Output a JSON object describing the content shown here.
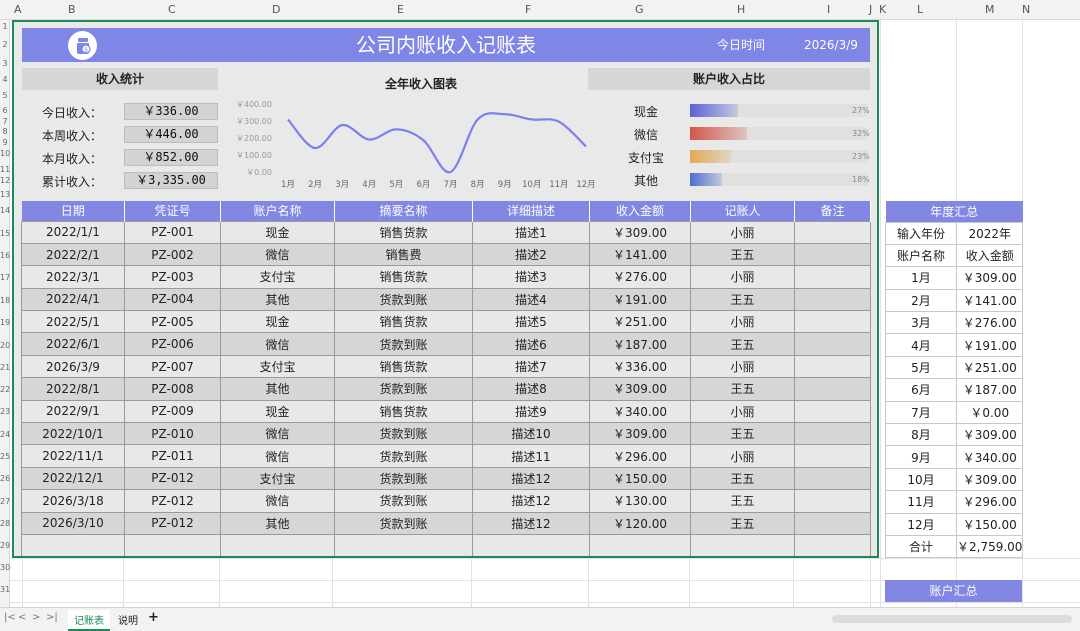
{
  "columns": [
    "A",
    "B",
    "C",
    "D",
    "E",
    "F",
    "G",
    "H",
    "I",
    "J",
    "K",
    "L",
    "M",
    "N"
  ],
  "rows": [
    "1",
    "2",
    "3",
    "4",
    "5",
    "6",
    "7",
    "8",
    "9",
    "10",
    "11",
    "12",
    "13",
    "14",
    "15",
    "16",
    "17",
    "18",
    "19",
    "20",
    "21",
    "22",
    "23",
    "24",
    "25",
    "26",
    "27",
    "28",
    "29",
    "30",
    "31"
  ],
  "banner": {
    "title": "公司内账收入记账表",
    "today_label": "今日时间",
    "today_date": "2026/3/9",
    "logo_icon": "money-bag-icon"
  },
  "stats": {
    "header": "收入统计",
    "items": [
      {
        "label": "今日收入：",
        "value": "￥336.00"
      },
      {
        "label": "本周收入：",
        "value": "￥446.00"
      },
      {
        "label": "本月收入：",
        "value": "￥852.00"
      },
      {
        "label": "累计收入：",
        "value": "￥3,335.00"
      }
    ]
  },
  "chart_data": {
    "type": "line",
    "title": "全年收入图表",
    "categories": [
      "1月",
      "2月",
      "3月",
      "4月",
      "5月",
      "6月",
      "7月",
      "8月",
      "9月",
      "10月",
      "11月",
      "12月"
    ],
    "values": [
      309,
      141,
      276,
      191,
      251,
      187,
      0,
      309,
      340,
      309,
      296,
      150
    ],
    "ylim": [
      0,
      400
    ],
    "yticks": [
      "￥0.00",
      "￥100.00",
      "￥200.00",
      "￥300.00",
      "￥400.00"
    ],
    "color": "#7b7ff0",
    "grid": false
  },
  "accounts": {
    "header": "账户收入占比",
    "items": [
      {
        "label": "现金",
        "pct": "27%",
        "fraction": 0.27,
        "color": "#5b63d6"
      },
      {
        "label": "微信",
        "pct": "32%",
        "fraction": 0.32,
        "color": "#d2574a"
      },
      {
        "label": "支付宝",
        "pct": "23%",
        "fraction": 0.23,
        "color": "#e2a955"
      },
      {
        "label": "其他",
        "pct": "18%",
        "fraction": 0.18,
        "color": "#4d6fcf"
      }
    ]
  },
  "table": {
    "headers": [
      "日期",
      "凭证号",
      "账户名称",
      "摘要名称",
      "详细描述",
      "收入金额",
      "记账人",
      "备注"
    ],
    "rows": [
      [
        "2022/1/1",
        "PZ-001",
        "现金",
        "销售货款",
        "描述1",
        "￥309.00",
        "小丽",
        ""
      ],
      [
        "2022/2/1",
        "PZ-002",
        "微信",
        "销售费",
        "描述2",
        "￥141.00",
        "王五",
        ""
      ],
      [
        "2022/3/1",
        "PZ-003",
        "支付宝",
        "销售货款",
        "描述3",
        "￥276.00",
        "小丽",
        ""
      ],
      [
        "2022/4/1",
        "PZ-004",
        "其他",
        "货款到账",
        "描述4",
        "￥191.00",
        "王五",
        ""
      ],
      [
        "2022/5/1",
        "PZ-005",
        "现金",
        "销售货款",
        "描述5",
        "￥251.00",
        "小丽",
        ""
      ],
      [
        "2022/6/1",
        "PZ-006",
        "微信",
        "货款到账",
        "描述6",
        "￥187.00",
        "王五",
        ""
      ],
      [
        "2026/3/9",
        "PZ-007",
        "支付宝",
        "销售货款",
        "描述7",
        "￥336.00",
        "小丽",
        ""
      ],
      [
        "2022/8/1",
        "PZ-008",
        "其他",
        "货款到账",
        "描述8",
        "￥309.00",
        "王五",
        ""
      ],
      [
        "2022/9/1",
        "PZ-009",
        "现金",
        "销售货款",
        "描述9",
        "￥340.00",
        "小丽",
        ""
      ],
      [
        "2022/10/1",
        "PZ-010",
        "微信",
        "货款到账",
        "描述10",
        "￥309.00",
        "王五",
        ""
      ],
      [
        "2022/11/1",
        "PZ-011",
        "微信",
        "货款到账",
        "描述11",
        "￥296.00",
        "小丽",
        ""
      ],
      [
        "2022/12/1",
        "PZ-012",
        "支付宝",
        "货款到账",
        "描述12",
        "￥150.00",
        "王五",
        ""
      ],
      [
        "2026/3/18",
        "PZ-012",
        "微信",
        "货款到账",
        "描述12",
        "￥130.00",
        "王五",
        ""
      ],
      [
        "2026/3/10",
        "PZ-012",
        "其他",
        "货款到账",
        "描述12",
        "￥120.00",
        "王五",
        ""
      ]
    ]
  },
  "annual": {
    "header": "年度汇总",
    "year_label": "输入年份",
    "year_value": "2022年",
    "col1": "账户名称",
    "col2": "收入金额",
    "months": [
      [
        "1月",
        "￥309.00"
      ],
      [
        "2月",
        "￥141.00"
      ],
      [
        "3月",
        "￥276.00"
      ],
      [
        "4月",
        "￥191.00"
      ],
      [
        "5月",
        "￥251.00"
      ],
      [
        "6月",
        "￥187.00"
      ],
      [
        "7月",
        "￥0.00"
      ],
      [
        "8月",
        "￥309.00"
      ],
      [
        "9月",
        "￥340.00"
      ],
      [
        "10月",
        "￥309.00"
      ],
      [
        "11月",
        "￥296.00"
      ],
      [
        "12月",
        "￥150.00"
      ]
    ],
    "total_label": "合计",
    "total_value": "￥2,759.00"
  },
  "account_summary": {
    "header": "账户汇总"
  },
  "sheets": {
    "tabs": [
      "记账表",
      "说明"
    ],
    "active": "记账表",
    "add": "+",
    "nav": [
      "|<",
      "<",
      ">",
      ">|"
    ]
  }
}
